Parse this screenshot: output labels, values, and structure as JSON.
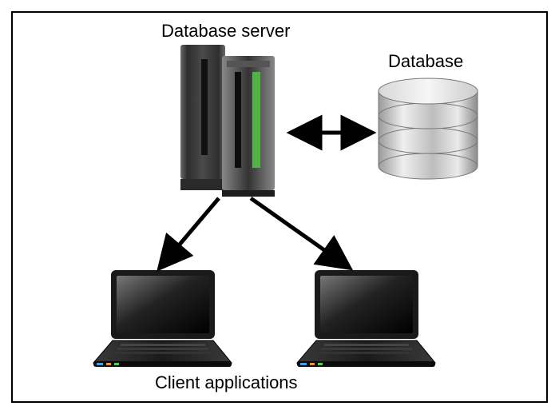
{
  "diagram": {
    "title_server": "Database server",
    "title_database": "Database",
    "title_clients": "Client applications",
    "nodes": {
      "server": {
        "role": "database-server",
        "icon": "server-rack-icon"
      },
      "database": {
        "role": "database-storage",
        "icon": "database-cylinder-icon"
      },
      "client1": {
        "role": "client-application",
        "icon": "laptop-icon"
      },
      "client2": {
        "role": "client-application",
        "icon": "laptop-icon"
      }
    },
    "edges": [
      {
        "from": "server",
        "to": "database",
        "direction": "bidirectional"
      },
      {
        "from": "server",
        "to": "client1",
        "direction": "to"
      },
      {
        "from": "server",
        "to": "client2",
        "direction": "to"
      }
    ]
  }
}
